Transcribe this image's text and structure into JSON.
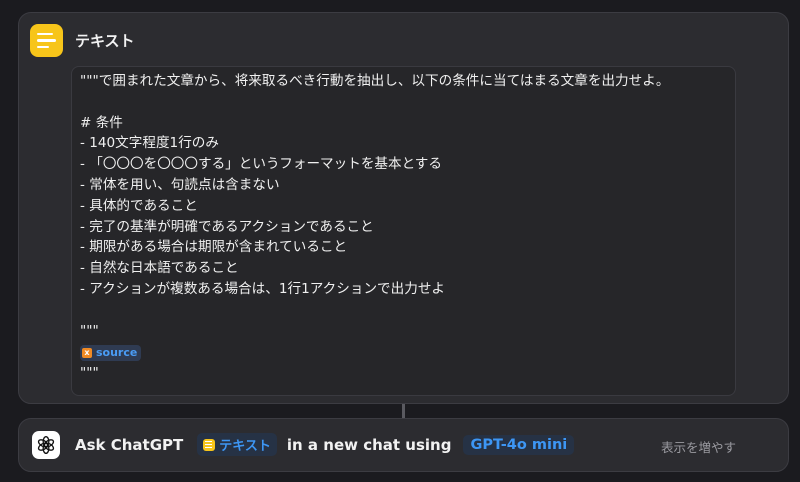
{
  "text_action": {
    "title": "テキスト",
    "lines": [
      "\"\"\"で囲まれた文章から、将来取るべき行動を抽出し、以下の条件に当てはまる文章を出力せよ。",
      "",
      "# 条件",
      "- 140文字程度1行のみ",
      "- 「〇〇〇を〇〇〇する」というフォーマットを基本とする",
      "- 常体を用い、句読点は含まない",
      "- 具体的であること",
      "- 完了の基準が明確であるアクションであること",
      "- 期限がある場合は期限が含まれていること",
      "- 自然な日本語であること",
      "- アクションが複数ある場合は、1行1アクションで出力せよ",
      "",
      "\"\"\""
    ],
    "variable": {
      "icon": "x",
      "label": "source"
    },
    "closing_quotes": "\"\"\""
  },
  "gpt_action": {
    "word_ask": "Ask ChatGPT",
    "input_chip": "テキスト",
    "word_middle": "in a new chat using",
    "model": "GPT-4o mini",
    "show_more": "表示を増やす"
  },
  "colors": {
    "background": "#1b1b1f",
    "card": "#2c2c30",
    "text_icon": "#f7c51a",
    "accent": "#3d96f4",
    "variable_icon": "#f08a24"
  },
  "icons": {
    "text_action": "text-lines-icon",
    "chatgpt": "openai-logo-icon",
    "variable": "variable-x-icon"
  }
}
